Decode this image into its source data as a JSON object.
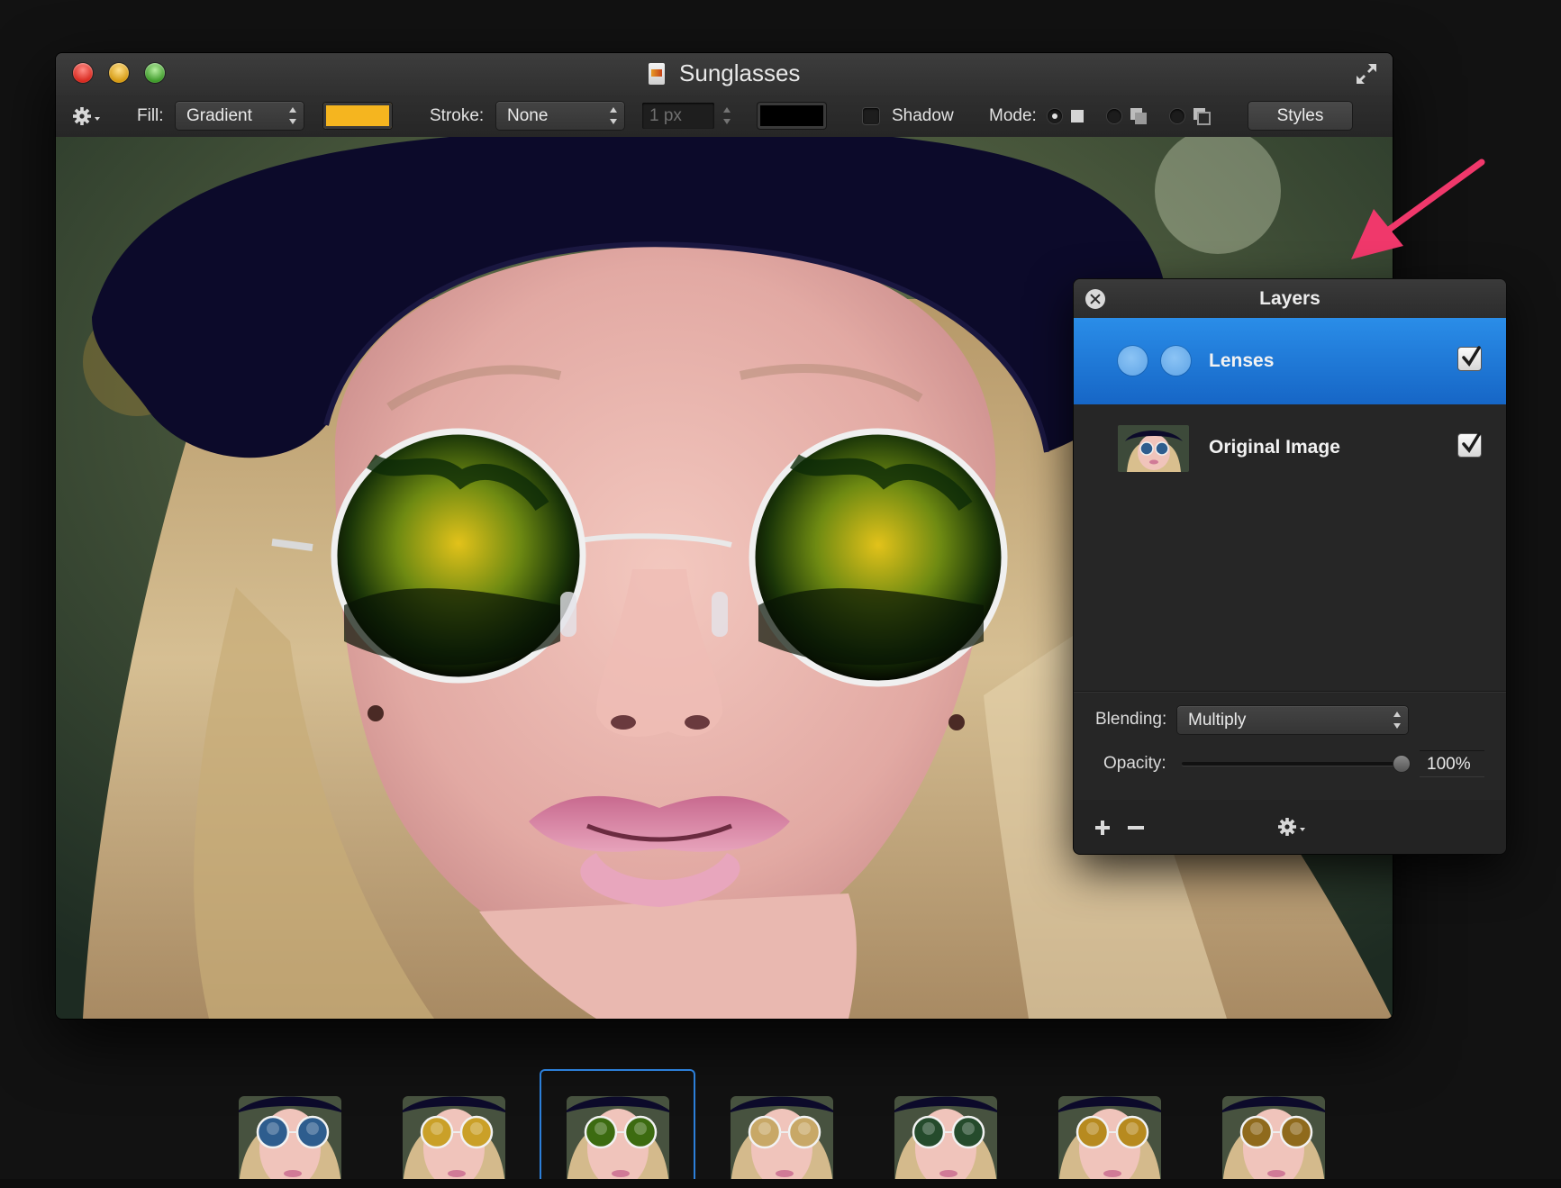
{
  "window": {
    "title": "Sunglasses"
  },
  "toolbar": {
    "fill_label": "Fill:",
    "fill_value": "Gradient",
    "fill_color": "#f5b51f",
    "stroke_label": "Stroke:",
    "stroke_value": "None",
    "stroke_width": "1 px",
    "stroke_color": "#000000",
    "shadow_label": "Shadow",
    "mode_label": "Mode:",
    "styles_label": "Styles"
  },
  "layers_panel": {
    "title": "Layers",
    "layers": [
      {
        "name": "Lenses",
        "visible": true,
        "selected": true
      },
      {
        "name": "Original Image",
        "visible": true,
        "selected": false
      }
    ],
    "blending_label": "Blending:",
    "blending_value": "Multiply",
    "opacity_label": "Opacity:",
    "opacity_value": "100%"
  },
  "style_presets": [
    {
      "name": "blue-chrome",
      "lens_color": "#2e5d8e"
    },
    {
      "name": "gold",
      "lens_color": "#caa028"
    },
    {
      "name": "green-yellow",
      "lens_color": "#3c6b10",
      "selected": true
    },
    {
      "name": "champagne",
      "lens_color": "#c8a867"
    },
    {
      "name": "dark-green",
      "lens_color": "#254b2c"
    },
    {
      "name": "amber",
      "lens_color": "#b78a1f"
    },
    {
      "name": "brown-gold",
      "lens_color": "#8f6a1c"
    }
  ],
  "colors": {
    "selection_blue": "#1f7ad8",
    "arrow_pink": "#f0386b"
  }
}
